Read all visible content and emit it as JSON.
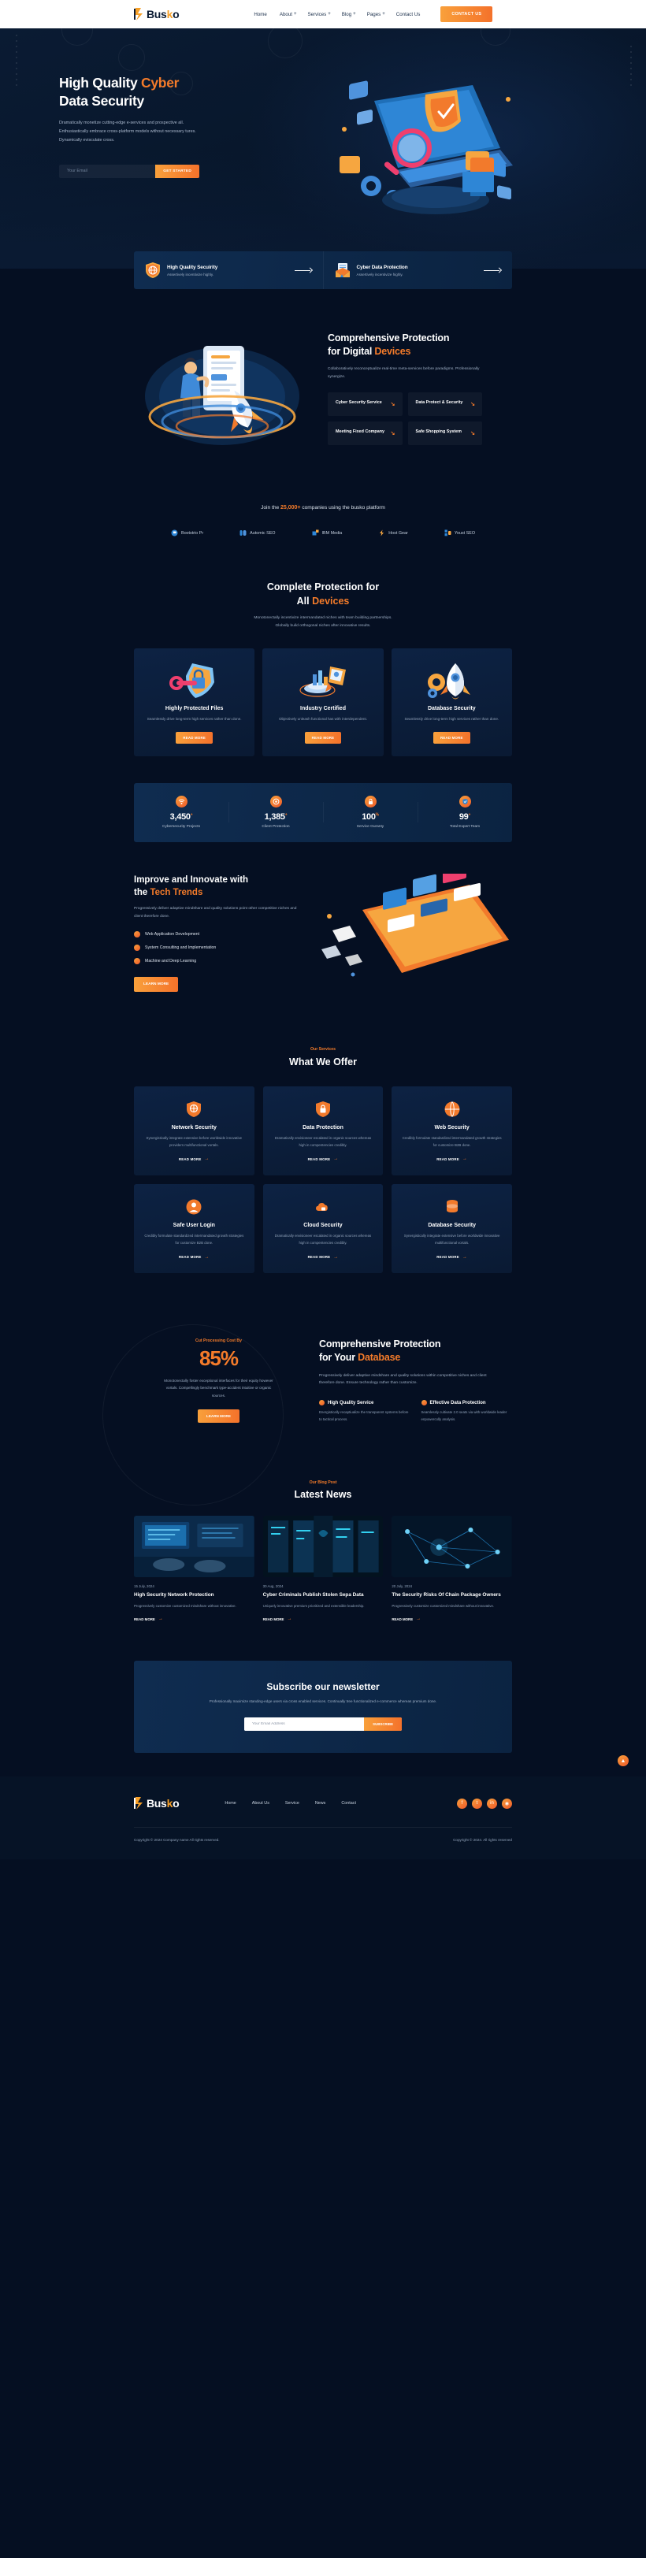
{
  "brand": {
    "name_1": "Bus",
    "name_accent": "k",
    "name_2": "o",
    "logo_icon": "busko-b-logo-icon"
  },
  "header": {
    "nav": [
      {
        "label": "Home",
        "caret": ""
      },
      {
        "label": "About",
        "caret": "+"
      },
      {
        "label": "Services",
        "caret": "+"
      },
      {
        "label": "Blog",
        "caret": "+"
      },
      {
        "label": "Pages",
        "caret": "+"
      },
      {
        "label": "Contact Us",
        "caret": ""
      }
    ],
    "cta": "CONTACT US"
  },
  "hero": {
    "title_1": "High Quality ",
    "title_accent": "Cyber",
    "title_2": "Data Security",
    "paragraph": "Dramatically monetize cutting-edge e-services and prospective all. Enthusiastically embrace cross-platform models without necessary tures. Dynamically evisculate cross.",
    "email_placeholder": "Your Email",
    "email_value": "",
    "submit": "GET STARTED"
  },
  "feature_strip": [
    {
      "icon": "shield-globe-icon",
      "title": "High Quality Secuirity",
      "sub": "Assertively incentivize highly.",
      "arrow": "arrow-right-icon"
    },
    {
      "icon": "mail-document-icon",
      "title": "Cyber Data Protection",
      "sub": "Assertively incentivize highly.",
      "arrow": "arrow-right-icon"
    }
  ],
  "comprehensive_digital": {
    "title_1": "Comprehensive Protection",
    "title_2": "for Digital ",
    "title_accent": "Devices",
    "paragraph": "Collaboratively reconceptualize real-time meta-services before paradigms. Professionally synergize.",
    "tiles": [
      {
        "label": "Cyber Security Service",
        "arrow": "arrow-down-right-icon"
      },
      {
        "label": "Data Protect & Security",
        "arrow": "arrow-down-right-icon"
      },
      {
        "label": "Meeting Fixed Company",
        "arrow": "arrow-down-right-icon"
      },
      {
        "label": "Safe Shopping System",
        "arrow": "arrow-down-right-icon"
      }
    ],
    "illustration": "rocket-person-mobile-illustration"
  },
  "brands": {
    "title_pre": "Join the ",
    "title_count": "25,000+",
    "title_post": " companies using the busko platform",
    "items": [
      {
        "icon": "bootstrio-icon",
        "label": "Bootstrio Pr"
      },
      {
        "icon": "automic-icon",
        "label": "Automic SEO"
      },
      {
        "icon": "ibm-media-icon",
        "label": "IBM Media"
      },
      {
        "icon": "host-gear-icon",
        "label": "Host Gear"
      },
      {
        "icon": "youst-seo-icon",
        "label": "Youst SEO"
      }
    ]
  },
  "complete_protection": {
    "title_1": "Complete Protection for",
    "title_2": "All ",
    "title_accent": "Devices",
    "paragraph_l1": "Monotonectally incentivize intermandated niches with team building partnerships.",
    "paragraph_l2": "Globally build orthogonal niches after innovative results.",
    "cards": [
      {
        "art": "key-lock-shield-illustration",
        "title": "Highly Protected Files",
        "text": "Seamlessly drive long-term high services rather than done.",
        "button": "READ MORE"
      },
      {
        "art": "certificate-chart-illustration",
        "title": "Industry Certified",
        "text": "Objectively unleash functional has with interdependent.",
        "button": "READ MORE"
      },
      {
        "art": "rocket-gear-illustration",
        "title": "Database Security",
        "text": "Seamlessly drive long-term high services rather than done.",
        "button": "READ MORE"
      }
    ]
  },
  "counters": [
    {
      "icon": "wifi-check-icon",
      "value": "3,450",
      "suffix": "+",
      "label": "Cybersecurity Projects"
    },
    {
      "icon": "shield-target-icon",
      "value": "1,385",
      "suffix": "+",
      "label": "Client Protection"
    },
    {
      "icon": "lock-icon",
      "value": "100",
      "suffix": "%",
      "label": "Service Guranty"
    },
    {
      "icon": "badge-check-icon",
      "value": "99",
      "suffix": "+",
      "label": "Total Expert Team"
    }
  ],
  "tech_trends": {
    "title_1": "Improve and Innovate with",
    "title_2": "the ",
    "title_accent": "Tech Trends",
    "paragraph": "Progressively deliver adaptive mindshare and quality solutions point other competitive niches and client therefore done.",
    "list": [
      "Web Application Development",
      "System Consulting and Implementation",
      "Machine and Deep Learning"
    ],
    "button": "LEARN MORE",
    "illustration": "tablet-devices-isometric-illustration"
  },
  "services": {
    "eyebrow": "Our Services",
    "title": "What We Offer",
    "cards": [
      {
        "icon": "network-security-icon",
        "title": "Network Security",
        "text": "Synergistically integrate extensive before worldwide innovative providers multifunctional vortals.",
        "more": "READ MORE"
      },
      {
        "icon": "data-protection-icon",
        "title": "Data Protection",
        "text": "Dramatically envisioneer escalated in organic sources whereas high in compentencies credibly.",
        "more": "READ MORE"
      },
      {
        "icon": "web-security-icon",
        "title": "Web Security",
        "text": "Credibly formulate standardized intermandated growth strategies for customize B2B done.",
        "more": "READ MORE"
      },
      {
        "icon": "safe-user-login-icon",
        "title": "Safe User Login",
        "text": "Credibly formulate standardized intermandated growth strategies for customize B2B done.",
        "more": "READ MORE"
      },
      {
        "icon": "cloud-security-icon",
        "title": "Cloud Security",
        "text": "Dramatically envisioneer escalated in organic sources whereas high in compentencies credibly.",
        "more": "READ MORE"
      },
      {
        "icon": "database-security-icon",
        "title": "Database Security",
        "text": "Synergistically integrate extensive before worldwide innovative multifunctional vortals.",
        "more": "READ MORE"
      }
    ]
  },
  "database": {
    "eyebrow": "Cut Processing Cost By",
    "percent": "85%",
    "paragraph": "Monotonectally foster exceptional interfaces for their equity however vortals. Compellingly benchmark type-accident intuitive or organic sources.",
    "button": "LEARN MORE",
    "title_1": "Comprehensive Protection",
    "title_2": "for Your ",
    "title_accent": "Database",
    "lead": "Progressively deliver adaptive mindshare and quality solutions within competitive niches and client therefore done. Ensure technology rather than customize.",
    "columns": [
      {
        "title": "High Quality Service",
        "text": "Energistically recaptiualize the transparent systems before to tactical process."
      },
      {
        "title": "Effective Data Protection",
        "text": "Seamlessly cultivate 2.0 seats via with worldwide leader enpowercolly analysis."
      }
    ]
  },
  "blog": {
    "eyebrow": "Our Blog Post",
    "title": "Latest News",
    "posts": [
      {
        "thumb": "hands-on-keyboard-photo",
        "date": "15 July, 2024",
        "title": "High Security Network Protection",
        "text": "Progressively customize customized mindshare without innovative.",
        "more": "READ MORE"
      },
      {
        "thumb": "server-room-photo",
        "date": "30 Aug, 2024",
        "title": "Cyber Criminals Publish Stolen Sepa Data",
        "text": "Uniquely innovative premium prioritized and extensible leadership.",
        "more": "READ MORE"
      },
      {
        "thumb": "network-nodes-photo",
        "date": "20 July, 2024",
        "title": "The Security Risks Of Chain Package Owners",
        "text": "Progressively customize customized mindshare without innovative.",
        "more": "READ MORE"
      }
    ]
  },
  "newsletter": {
    "title": "Subscribe our newsletter",
    "paragraph": "Professionally maximize standing-edge users via cross enabled services. Continually tree functionalized e-commerce whereas premium done.",
    "placeholder": "Your Email Address",
    "value": "",
    "button": "SUBSCRIBE"
  },
  "footer": {
    "nav": [
      "Home",
      "About Us",
      "Service",
      "News",
      "Contact"
    ],
    "social": [
      {
        "icon": "facebook-icon",
        "glyph": "f"
      },
      {
        "icon": "twitter-icon",
        "glyph": "t"
      },
      {
        "icon": "linkedin-icon",
        "glyph": "in"
      },
      {
        "icon": "instagram-icon",
        "glyph": "◉"
      }
    ],
    "copyright_left": "Copyright © 2024 Company name All rights reserved.",
    "copyright_right": "Copyright © 2024. All rights reserved"
  },
  "scroll_top": {
    "icon": "arrow-up-icon",
    "glyph": "▲"
  },
  "colors": {
    "accent": "#f47b2a",
    "accent2": "#f9a03b",
    "bg": "#061326",
    "panel": "#0d2243"
  }
}
